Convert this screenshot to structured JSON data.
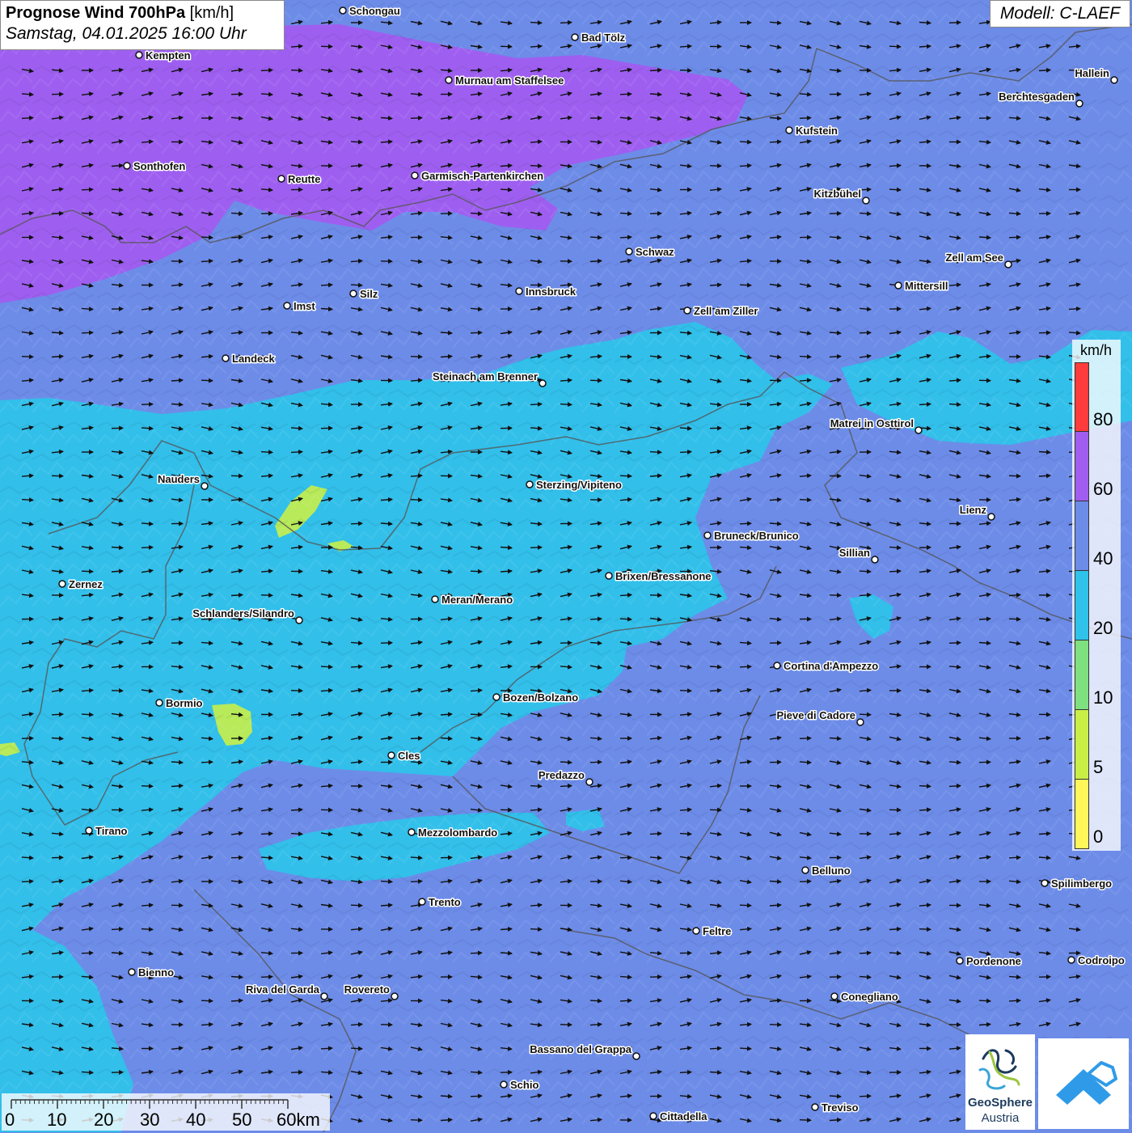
{
  "header": {
    "title_bold": "Prognose Wind 700hPa",
    "title_unit": "[km/h]",
    "subtitle": "Samstag, 04.01.2025 16:00 Uhr",
    "model": "Modell: C-LAEF"
  },
  "legend": {
    "unit": "km/h",
    "ticks": [
      "80",
      "60",
      "40",
      "20",
      "10",
      "5",
      "0"
    ],
    "colors": [
      "#ff3b3b",
      "#a15df0",
      "#6d8ce8",
      "#2fc2ea",
      "#7ee07f",
      "#c9ef47",
      "#fff65a"
    ]
  },
  "scalebar": {
    "labels": [
      "0",
      "10",
      "20",
      "30",
      "40",
      "50",
      "60km"
    ]
  },
  "logos": {
    "geosphere_line1": "GeoSphere",
    "geosphere_line2": "Austria"
  },
  "wind": {
    "direction": "from west",
    "dominant_speed_class": "40-60 km/h"
  },
  "cities": [
    {
      "name": "Schongau"
    },
    {
      "name": "Bad Tölz"
    },
    {
      "name": "Kempten"
    },
    {
      "name": "Murnau am Staffelsee"
    },
    {
      "name": "Hallein"
    },
    {
      "name": "Berchtesgaden"
    },
    {
      "name": "Kufstein"
    },
    {
      "name": "Sonthofen"
    },
    {
      "name": "Reutte"
    },
    {
      "name": "Garmisch-Partenkirchen"
    },
    {
      "name": "Kitzbühel"
    },
    {
      "name": "Schwaz"
    },
    {
      "name": "Zell am See"
    },
    {
      "name": "Mittersill"
    },
    {
      "name": "Imst"
    },
    {
      "name": "Silz"
    },
    {
      "name": "Innsbruck"
    },
    {
      "name": "Zell am Ziller"
    },
    {
      "name": "Landeck"
    },
    {
      "name": "Steinach am Brenner"
    },
    {
      "name": "Matrei in Osttirol"
    },
    {
      "name": "Nauders"
    },
    {
      "name": "Sterzing/Vipiteno"
    },
    {
      "name": "Lienz"
    },
    {
      "name": "Bruneck/Brunico"
    },
    {
      "name": "Sillian"
    },
    {
      "name": "Brixen/Bressanone"
    },
    {
      "name": "Zernez"
    },
    {
      "name": "Meran/Merano"
    },
    {
      "name": "Schlanders/Silandro"
    },
    {
      "name": "Cortina d'Ampezzo"
    },
    {
      "name": "Bozen/Bolzano"
    },
    {
      "name": "Bormio"
    },
    {
      "name": "Pieve di Cadore"
    },
    {
      "name": "Cles"
    },
    {
      "name": "Predazzo"
    },
    {
      "name": "Tirano"
    },
    {
      "name": "Mezzolombardo"
    },
    {
      "name": "Belluno"
    },
    {
      "name": "Spilimbergo"
    },
    {
      "name": "Trento"
    },
    {
      "name": "Feltre"
    },
    {
      "name": "Pordenone"
    },
    {
      "name": "Codroipo"
    },
    {
      "name": "Bienno"
    },
    {
      "name": "Riva del Garda"
    },
    {
      "name": "Rovereto"
    },
    {
      "name": "Conegliano"
    },
    {
      "name": "Bassano del Grappa"
    },
    {
      "name": "Schio"
    },
    {
      "name": "Treviso"
    },
    {
      "name": "Cittadella"
    }
  ]
}
